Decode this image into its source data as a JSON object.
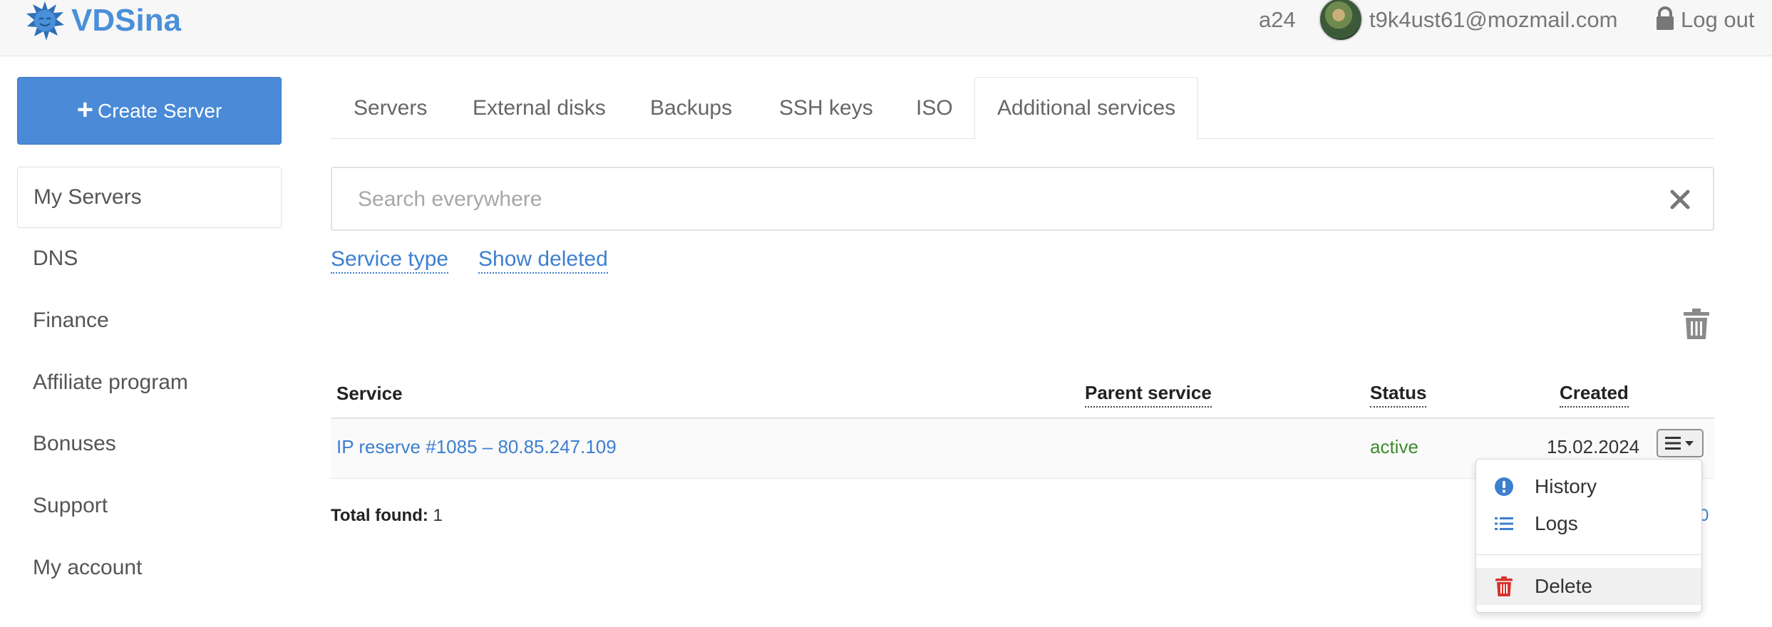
{
  "header": {
    "logo_text": "VDSina",
    "user_id": "a24",
    "email": "t9k4ust61@mozmail.com",
    "logout_label": "Log out"
  },
  "sidebar": {
    "create_button_label": "Create Server",
    "items": [
      {
        "label": "My Servers",
        "active": true
      },
      {
        "label": "DNS"
      },
      {
        "label": "Finance"
      },
      {
        "label": "Affiliate program"
      },
      {
        "label": "Bonuses"
      },
      {
        "label": "Support"
      },
      {
        "label": "My account"
      }
    ]
  },
  "tabs": [
    {
      "label": "Servers"
    },
    {
      "label": "External disks"
    },
    {
      "label": "Backups"
    },
    {
      "label": "SSH keys"
    },
    {
      "label": "ISO"
    },
    {
      "label": "Additional services",
      "active": true
    }
  ],
  "search": {
    "placeholder": "Search everywhere",
    "value": ""
  },
  "filters": {
    "service_type": "Service type",
    "show_deleted": "Show deleted"
  },
  "table": {
    "columns": [
      "Service",
      "Parent service",
      "Status",
      "Created"
    ],
    "rows": [
      {
        "service": "IP reserve #1085 – 80.85.247.109",
        "parent_service": "",
        "status": "active",
        "created": "15.02.2024"
      }
    ]
  },
  "footer": {
    "total_label": "Total found:",
    "total_value": "1",
    "pager_peek": "0"
  },
  "row_menu": {
    "items": [
      {
        "label": "History",
        "icon": "exclamation-circle-icon"
      },
      {
        "label": "Logs",
        "icon": "list-icon"
      },
      {
        "label": "Delete",
        "icon": "trash-icon"
      }
    ]
  },
  "colors": {
    "accent": "#4a8ad6",
    "link": "#3d7fcf",
    "status_active": "#3c8c2c",
    "danger": "#d9332b"
  }
}
